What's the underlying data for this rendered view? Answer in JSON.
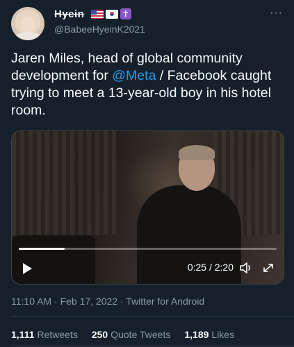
{
  "user": {
    "display_name": "Hyein",
    "handle": "@BabeeHyeinK2021",
    "flags": [
      "us-flag-icon",
      "kr-flag-icon",
      "latin-cross-icon"
    ]
  },
  "tweet": {
    "text_before": "Jaren Miles, head of global community development for ",
    "mention": "@Meta",
    "text_after": " / Facebook caught trying to meet a 13-year-old boy in his hotel room."
  },
  "video": {
    "time": "0:25 / 2:20",
    "progress": 0.179
  },
  "meta": {
    "time": "11:10 AM",
    "date": "Feb 17, 2022",
    "source": "Twitter for Android"
  },
  "stats": {
    "retweets_count": "1,111",
    "retweets_label": "Retweets",
    "quotes_count": "250",
    "quotes_label": "Quote Tweets",
    "likes_count": "1,189",
    "likes_label": "Likes"
  },
  "colors": {
    "background": "#15202b",
    "accent": "#1d9bf0",
    "muted": "#8b98a5"
  }
}
